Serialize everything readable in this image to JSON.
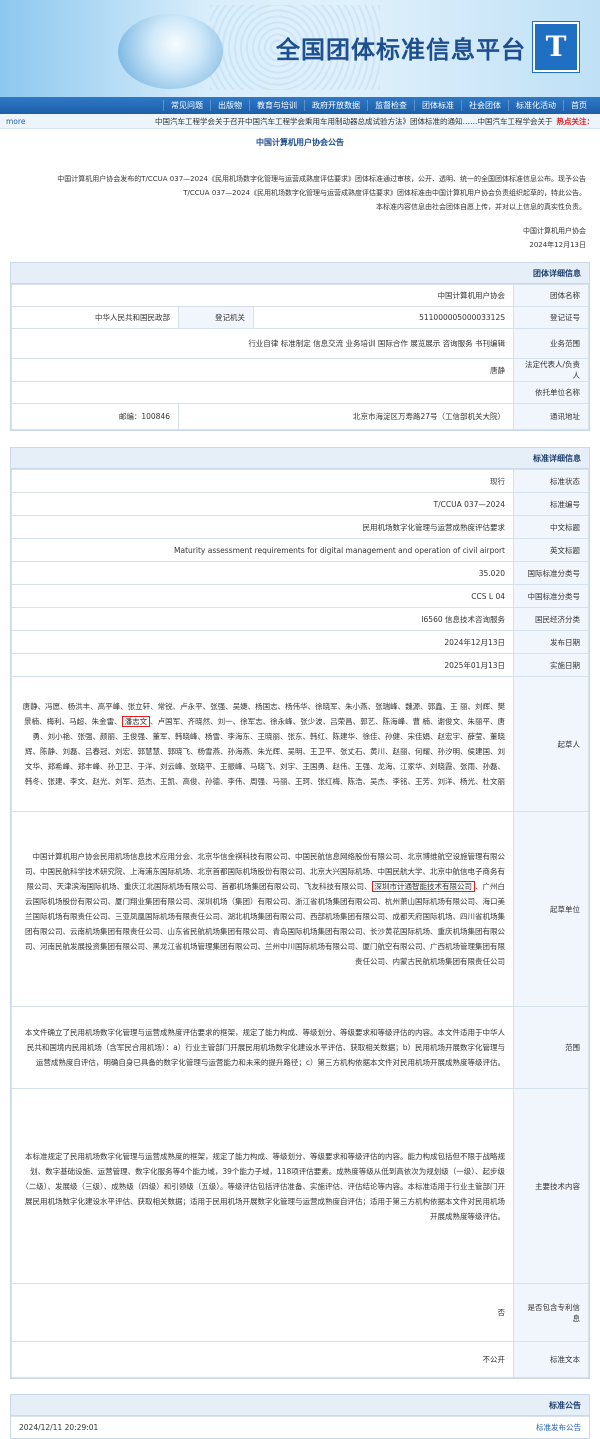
{
  "header": {
    "site_title": "全国团体标准信息平台",
    "logo_char": "T"
  },
  "nav": [
    "首页",
    "标准化活动",
    "社会团体",
    "团体标准",
    "监督检查",
    "政府开放数据",
    "教育与培训",
    "出版物",
    "常见问题"
  ],
  "hot": {
    "label": "热点关注：",
    "text": "中国汽车工程学会关于召开中国汽车工程学会乘用车用制动器总成试验方法》团体标准的通知……中国汽车工程学会关于",
    "more": "more"
  },
  "notice": {
    "title": "中国计算机用户协会公告",
    "paragraphs": [
      "中国计算机用户协会发布的T/CCUA 037—2024《民用机场数字化管理与运营成熟度评估要求》团体标准通过审核，公开、透明、统一的全国团体标准信息公布。现予公告",
      "T/CCUA 037—2024《民用机场数字化管理与运营成熟度评估要求》团体标准由中国计算机用户协会负责组织起草的，特此公告。",
      "本标准内容信息由社会团体自愿上传，并对以上信息的真实性负责。"
    ],
    "signer": "中国计算机用户协会",
    "date": "2024年12月13日"
  },
  "org": {
    "heading": "团体详细信息",
    "rows": {
      "name_label": "团体名称",
      "name": "中国计算机用户协会",
      "code_label": "登记证号",
      "code": "51100000500003312S",
      "reg_label": "登记机关",
      "reg": "中华人民共和国民政部",
      "scope_label": "业务范围",
      "scope": "行业自律 标准制定 信息交流 业务培训 国际合作 展览展示 咨询服务 书刊编辑",
      "legal_label": "法定代表人/负责人",
      "legal": "唐静",
      "unit_label": "依托单位名称",
      "unit": "",
      "addr_label": "通讯地址",
      "addr": "北京市海淀区万寿路27号（工信部机关大院）",
      "post_label": "邮编：",
      "post": "100846"
    }
  },
  "standard": {
    "heading": "标准详细信息",
    "status_label": "标准状态",
    "status": "现行",
    "no_label": "标准编号",
    "no": "T/CCUA 037—2024",
    "cn_label": "中文标题",
    "cn": "民用机场数字化管理与运营成熟度评估要求",
    "en_label": "英文标题",
    "en": "Maturity assessment requirements for digital management and operation of civil airport",
    "ics_label": "国际标准分类号",
    "ics": "35.020",
    "ccs_label": "中国标准分类号",
    "ccs": "CCS L 04",
    "eco_label": "国民经济分类",
    "eco": "I6560 信息技术咨询服务",
    "pub_label": "发布日期",
    "pub": "2024年12月13日",
    "impl_label": "实施日期",
    "impl": "2025年01月13日",
    "drafter_label": "起草人",
    "drafter_pre": "唐静、冯愿、杨洪丰、高平峰、张立轩、常锐、卢永平、张强、吴婕、杨国志、杨伟华、徐晓军、朱小燕、张瑞峰、魏源、郭鑫、王 丽、刘辉、樊景楠、梅利、马超、朱金雷、",
    "drafter_hl": "潘志文",
    "drafter_post": "、卢国军、齐晓然、刘一、徐军志、徐永峰、张少波、吕荣昌、郭艺、陈海峰、曹 楠、谢俊文、朱丽平、唐勇、刘小艳、张强、颜丽、王俊强、董军、韩晓峰、杨雪、李海东、王晓丽、张东、韩红、陈建华、徐佳、孙健、宋佳娟、赵宏宇、薛莹、董晓辉、陈静、刘磊、吕春冠、刘宏、郭慧慧、郭晓飞、杨雪燕、孙海燕、朱光辉、吴明、王卫平、张丈石、黄川、赵丽、何耀、孙汐明、侯建国、刘文华、郑希峰、郑丰峰、孙卫卫、于洋、刘云峰、张晓平、王振峰、马晓飞、刘宇、王国勇、赵伟、王强、龙海、江家华、刘晓霞、张雨、孙磊、韩冬、张建、李文、赵光、刘军、范杰、王凯、高俊、孙德、李伟、周强、马丽、王珂、张红梅、陈浩、吴杰、李铭、王芳、刘洋、杨光、杜文丽",
    "unit_label": "起草单位",
    "unit_pre": "中国计算机用户协会民用机场信息技术应用分会、北京华信金祺科技有限公司、中国民航信息网络股份有限公司、北京博维航空设施管理有限公司、中国民航科学技术研究院、上海浦东国际机场、北京首都国际机场股份有限公司、北京大兴国际机场、中国民航大学、北京中航信电子商务有限公司、天津滨海国际机场、重庆江北国际机场有限公司、首都机场集团有限公司、飞友科技有限公司、",
    "unit_hl": "深圳市计通智能技术有限公司",
    "unit_post": "、广州白云国际机场股份有限公司、厦门翔业集团有限公司、深圳机场（集团）有限公司、浙江省机场集团有限公司、杭州萧山国际机场有限公司、海口美兰国际机场有限责任公司、三亚凤凰国际机场有限责任公司、湖北机场集团有限公司、西部机场集团有限公司、成都天府国际机场、四川省机场集团有限公司、云南机场集团有限责任公司、山东省民航机场集团有限公司、青岛国际机场集团有限公司、长沙黄花国际机场、重庆机场集团有限公司、河南民航发展投资集团有限公司、黑龙江省机场管理集团有限公司、兰州中川国际机场有限公司、厦门航空有限公司、广西机场管理集团有限责任公司、内蒙古民航机场集团有限责任公司",
    "range_label": "范围",
    "range": "本文件确立了民用机场数字化管理与运营成熟度评估要求的框架，规定了能力构成、等级划分、等级要求和等级评估的内容。本文件适用于中华人民共和国境内民用机场（含军民合用机场）：a）行业主管部门开展民用机场数字化建设水平评估、获取相关数据；b）民用机场开展数字化管理与运营成熟度自评估，明确自身已具备的数字化管理与运营能力和未来的提升路径；c）第三方机构依据本文件对民用机场开展成熟度等级评估。",
    "tech_label": "主要技术内容",
    "tech": "本标准规定了民用机场数字化管理与运营成熟度的框架，规定了能力构成、等级划分、等级要求和等级评估的内容。能力构成包括但不限于战略规划、数字基础设施、运营管理、数字化服务等4个能力域，39个能力子域，118项评估要素。成熟度等级从低到高依次为规划级（一级）、起步级（二级）、发展级（三级）、成熟级（四级）和引领级（五级）。等级评估包括评估准备、实施评估、评估结论等内容。本标准适用于行业主管部门开展民用机场数字化建设水平评估、获取相关数据；适用于民用机场开展数字化管理与运营成熟度自评估；适用于第三方机构依据本文件对民用机场开展成熟度等级评估。",
    "patent_label": "是否包含专利信息",
    "patent": "否",
    "text_label": "标准文本",
    "text": "不公开"
  },
  "announce": {
    "heading": "标准公告",
    "link": "标准发布公告",
    "time": "2024/12/11 20:29:01"
  }
}
